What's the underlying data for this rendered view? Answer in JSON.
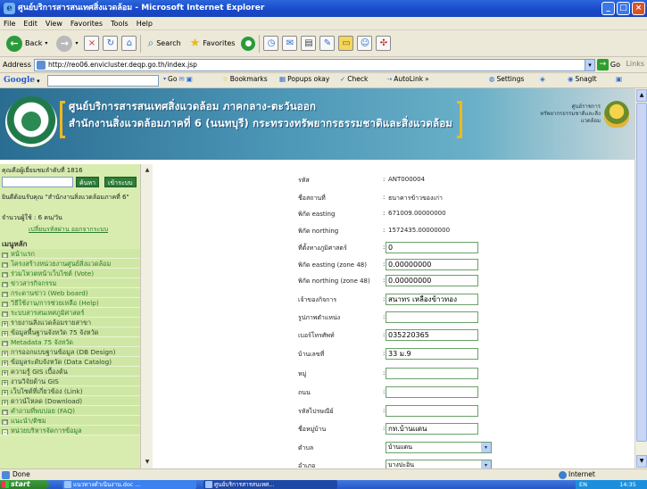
{
  "window": {
    "title": "ศูนย์บริการสารสนเทศสิ่งแวดล้อม - Microsoft Internet Explorer"
  },
  "menubar": [
    "File",
    "Edit",
    "View",
    "Favorites",
    "Tools",
    "Help"
  ],
  "toolbar": {
    "back": "Back",
    "search": "Search",
    "favorites": "Favorites"
  },
  "address": {
    "label": "Address",
    "url": "http://reo06.envicluster.deqp.go.th/index.jsp",
    "go": "Go",
    "links": "Links"
  },
  "googlebar": {
    "logo": "Google",
    "go": "Go",
    "bookmarks": "Bookmarks",
    "popups": "Popups okay",
    "check": "Check",
    "autolink": "AutoLink",
    "more": "»",
    "settings": "Settings",
    "snagit": "SnagIt"
  },
  "banner": {
    "line1": "ศูนย์บริการสารสนเทศสิ่งแวดล้อม ภาคกลาง-ตะวันออก",
    "line2": "สำนักงานสิ่งแวดล้อมภาคที่ 6 (นนทบุรี) กระทรวงทรัพยากรธรรมชาติและสิ่งแวดล้อม",
    "ministry": "ศูนย์ราชการทรัพยากรธรรมชาติและสิ่งแวดล้อม"
  },
  "sidebar": {
    "visitor": "คุณคือผู้เยี่ยมชมลำดับที่ 1816",
    "search_btn": "ค้นหา",
    "login_btn": "เข้าระบบ",
    "welcome": "ยินดีต้อนรับคุณ \"สำนักงานสิ่งแวดล้อมภาคที่ 6\"",
    "visits": "จำนวนผู้ใช้ : 6 คน/วัน",
    "links": "เปลี่ยนรหัสผ่าน ออกจากระบบ",
    "menu_head": "เมนูหลัก",
    "menu": [
      {
        "label": "หน้าแรก",
        "mark": "□"
      },
      {
        "label": "โครงสร้างหน่วยงานศูนย์สิ่งแวดล้อม",
        "mark": "□"
      },
      {
        "label": "ร่วมโหวตหน้าเว็บไซต์ (Vote)",
        "mark": "□"
      },
      {
        "label": "ข่าวสารกิจกรรม",
        "mark": "□"
      },
      {
        "label": "กระดานข่าว (Web board)",
        "mark": "□"
      },
      {
        "label": "วิธีใช้งาน/การช่วยเหลือ (Help)",
        "mark": "□"
      },
      {
        "label": "ระบบสารสนเทศภูมิศาสตร์",
        "mark": "□"
      },
      {
        "label": "รายงานสิ่งแวดล้อมรายสาขา",
        "mark": "+"
      },
      {
        "label": "ข้อมูลพื้นฐานจังหวัด 75 จังหวัด",
        "mark": "+"
      },
      {
        "label": "Metadata 75 จังหวัด",
        "mark": "□"
      },
      {
        "label": "การออกแบบฐานข้อมูล (DB Design)",
        "mark": "+"
      },
      {
        "label": "ข้อมูลระดับจังหวัด (Data Catalog)",
        "mark": "+"
      },
      {
        "label": "ความรู้ GIS เบื้องต้น",
        "mark": "+"
      },
      {
        "label": "งานวิจัยด้าน GIS",
        "mark": "+"
      },
      {
        "label": "เว็บไซต์ที่เกี่ยวข้อง (Link)",
        "mark": "+"
      },
      {
        "label": "ดาวน์โหลด (Download)",
        "mark": "+"
      },
      {
        "label": "คำถามที่พบบ่อย (FAQ)",
        "mark": "□"
      },
      {
        "label": "แนะนำ/ติชม",
        "mark": "□"
      },
      {
        "label": "หน่วยบริหารจัดการข้อมูล",
        "mark": "-"
      }
    ]
  },
  "form": {
    "rows": [
      {
        "label": "รหัส",
        "value": "ANT000004",
        "kind": "text"
      },
      {
        "label": "ชื่อสถานที่",
        "value": "ธนาคารข้าวของเก่า",
        "kind": "text"
      },
      {
        "label": "พิกัด easting",
        "value": "671009.00000000",
        "kind": "text"
      },
      {
        "label": "พิกัด northing",
        "value": "1572435.00000000",
        "kind": "text"
      },
      {
        "label": "ที่ตั้งทางภูมิศาสตร์",
        "value": "0",
        "kind": "input"
      },
      {
        "label": "พิกัด easting (zone 48)",
        "value": "0.00000000",
        "kind": "input"
      },
      {
        "label": "พิกัด northing (zone 48)",
        "value": "0.00000000",
        "kind": "input"
      },
      {
        "label": "เจ้าของกิจการ",
        "value": "สนาทร เหลืองข้าวทอง",
        "kind": "input"
      },
      {
        "label": "รูปภาพตำแหน่ง",
        "value": "",
        "kind": "input"
      },
      {
        "label": "เบอร์โทรศัพท์",
        "value": "035220365",
        "kind": "input"
      },
      {
        "label": "บ้านเลขที่",
        "value": "33 ม.9",
        "kind": "input"
      },
      {
        "label": "หมู่",
        "value": "",
        "kind": "input"
      },
      {
        "label": "ถนน",
        "value": "",
        "kind": "input"
      },
      {
        "label": "รหัสไปรษณีย์",
        "value": "",
        "kind": "input"
      },
      {
        "label": "ชื่อหมู่บ้าน",
        "value": "กท.บ้านแดน",
        "kind": "input"
      },
      {
        "label": "ตำบล",
        "value": "บ้านแดน",
        "kind": "select"
      },
      {
        "label": "อำเภอ",
        "value": "บางปะอิน",
        "kind": "select"
      }
    ]
  },
  "status": {
    "text": "Done",
    "zone": "Internet"
  },
  "taskbar": {
    "start": "start",
    "tasks": [
      "แนวทางดำเนินงาน.doc ...",
      "ศูนย์บริการสารสนเทศ..."
    ],
    "tray": "EN",
    "clock": "14:35"
  },
  "colors": {
    "sidebar_bg": "#d8ecb0",
    "banner_blue": "#2a6d92",
    "link_green": "#2a7d2a"
  }
}
